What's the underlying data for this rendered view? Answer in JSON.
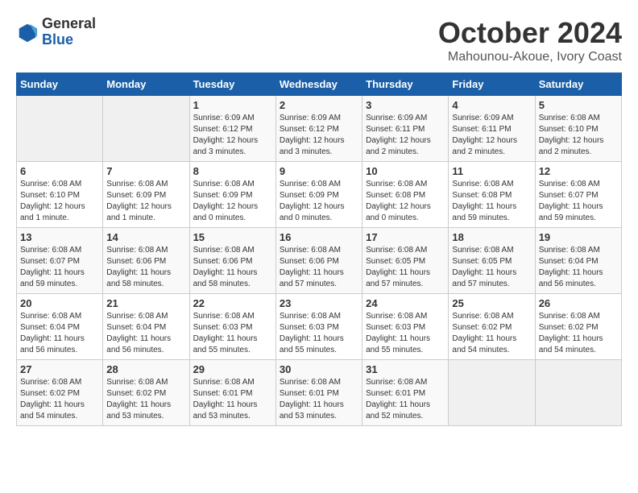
{
  "header": {
    "logo_general": "General",
    "logo_blue": "Blue",
    "title": "October 2024",
    "subtitle": "Mahounou-Akoue, Ivory Coast"
  },
  "weekdays": [
    "Sunday",
    "Monday",
    "Tuesday",
    "Wednesday",
    "Thursday",
    "Friday",
    "Saturday"
  ],
  "weeks": [
    [
      {
        "day": "",
        "empty": true
      },
      {
        "day": "",
        "empty": true
      },
      {
        "day": "1",
        "sunrise": "Sunrise: 6:09 AM",
        "sunset": "Sunset: 6:12 PM",
        "daylight": "Daylight: 12 hours and 3 minutes."
      },
      {
        "day": "2",
        "sunrise": "Sunrise: 6:09 AM",
        "sunset": "Sunset: 6:12 PM",
        "daylight": "Daylight: 12 hours and 3 minutes."
      },
      {
        "day": "3",
        "sunrise": "Sunrise: 6:09 AM",
        "sunset": "Sunset: 6:11 PM",
        "daylight": "Daylight: 12 hours and 2 minutes."
      },
      {
        "day": "4",
        "sunrise": "Sunrise: 6:09 AM",
        "sunset": "Sunset: 6:11 PM",
        "daylight": "Daylight: 12 hours and 2 minutes."
      },
      {
        "day": "5",
        "sunrise": "Sunrise: 6:08 AM",
        "sunset": "Sunset: 6:10 PM",
        "daylight": "Daylight: 12 hours and 2 minutes."
      }
    ],
    [
      {
        "day": "6",
        "sunrise": "Sunrise: 6:08 AM",
        "sunset": "Sunset: 6:10 PM",
        "daylight": "Daylight: 12 hours and 1 minute."
      },
      {
        "day": "7",
        "sunrise": "Sunrise: 6:08 AM",
        "sunset": "Sunset: 6:09 PM",
        "daylight": "Daylight: 12 hours and 1 minute."
      },
      {
        "day": "8",
        "sunrise": "Sunrise: 6:08 AM",
        "sunset": "Sunset: 6:09 PM",
        "daylight": "Daylight: 12 hours and 0 minutes."
      },
      {
        "day": "9",
        "sunrise": "Sunrise: 6:08 AM",
        "sunset": "Sunset: 6:09 PM",
        "daylight": "Daylight: 12 hours and 0 minutes."
      },
      {
        "day": "10",
        "sunrise": "Sunrise: 6:08 AM",
        "sunset": "Sunset: 6:08 PM",
        "daylight": "Daylight: 12 hours and 0 minutes."
      },
      {
        "day": "11",
        "sunrise": "Sunrise: 6:08 AM",
        "sunset": "Sunset: 6:08 PM",
        "daylight": "Daylight: 11 hours and 59 minutes."
      },
      {
        "day": "12",
        "sunrise": "Sunrise: 6:08 AM",
        "sunset": "Sunset: 6:07 PM",
        "daylight": "Daylight: 11 hours and 59 minutes."
      }
    ],
    [
      {
        "day": "13",
        "sunrise": "Sunrise: 6:08 AM",
        "sunset": "Sunset: 6:07 PM",
        "daylight": "Daylight: 11 hours and 59 minutes."
      },
      {
        "day": "14",
        "sunrise": "Sunrise: 6:08 AM",
        "sunset": "Sunset: 6:06 PM",
        "daylight": "Daylight: 11 hours and 58 minutes."
      },
      {
        "day": "15",
        "sunrise": "Sunrise: 6:08 AM",
        "sunset": "Sunset: 6:06 PM",
        "daylight": "Daylight: 11 hours and 58 minutes."
      },
      {
        "day": "16",
        "sunrise": "Sunrise: 6:08 AM",
        "sunset": "Sunset: 6:06 PM",
        "daylight": "Daylight: 11 hours and 57 minutes."
      },
      {
        "day": "17",
        "sunrise": "Sunrise: 6:08 AM",
        "sunset": "Sunset: 6:05 PM",
        "daylight": "Daylight: 11 hours and 57 minutes."
      },
      {
        "day": "18",
        "sunrise": "Sunrise: 6:08 AM",
        "sunset": "Sunset: 6:05 PM",
        "daylight": "Daylight: 11 hours and 57 minutes."
      },
      {
        "day": "19",
        "sunrise": "Sunrise: 6:08 AM",
        "sunset": "Sunset: 6:04 PM",
        "daylight": "Daylight: 11 hours and 56 minutes."
      }
    ],
    [
      {
        "day": "20",
        "sunrise": "Sunrise: 6:08 AM",
        "sunset": "Sunset: 6:04 PM",
        "daylight": "Daylight: 11 hours and 56 minutes."
      },
      {
        "day": "21",
        "sunrise": "Sunrise: 6:08 AM",
        "sunset": "Sunset: 6:04 PM",
        "daylight": "Daylight: 11 hours and 56 minutes."
      },
      {
        "day": "22",
        "sunrise": "Sunrise: 6:08 AM",
        "sunset": "Sunset: 6:03 PM",
        "daylight": "Daylight: 11 hours and 55 minutes."
      },
      {
        "day": "23",
        "sunrise": "Sunrise: 6:08 AM",
        "sunset": "Sunset: 6:03 PM",
        "daylight": "Daylight: 11 hours and 55 minutes."
      },
      {
        "day": "24",
        "sunrise": "Sunrise: 6:08 AM",
        "sunset": "Sunset: 6:03 PM",
        "daylight": "Daylight: 11 hours and 55 minutes."
      },
      {
        "day": "25",
        "sunrise": "Sunrise: 6:08 AM",
        "sunset": "Sunset: 6:02 PM",
        "daylight": "Daylight: 11 hours and 54 minutes."
      },
      {
        "day": "26",
        "sunrise": "Sunrise: 6:08 AM",
        "sunset": "Sunset: 6:02 PM",
        "daylight": "Daylight: 11 hours and 54 minutes."
      }
    ],
    [
      {
        "day": "27",
        "sunrise": "Sunrise: 6:08 AM",
        "sunset": "Sunset: 6:02 PM",
        "daylight": "Daylight: 11 hours and 54 minutes."
      },
      {
        "day": "28",
        "sunrise": "Sunrise: 6:08 AM",
        "sunset": "Sunset: 6:02 PM",
        "daylight": "Daylight: 11 hours and 53 minutes."
      },
      {
        "day": "29",
        "sunrise": "Sunrise: 6:08 AM",
        "sunset": "Sunset: 6:01 PM",
        "daylight": "Daylight: 11 hours and 53 minutes."
      },
      {
        "day": "30",
        "sunrise": "Sunrise: 6:08 AM",
        "sunset": "Sunset: 6:01 PM",
        "daylight": "Daylight: 11 hours and 53 minutes."
      },
      {
        "day": "31",
        "sunrise": "Sunrise: 6:08 AM",
        "sunset": "Sunset: 6:01 PM",
        "daylight": "Daylight: 11 hours and 52 minutes."
      },
      {
        "day": "",
        "empty": true
      },
      {
        "day": "",
        "empty": true
      }
    ]
  ]
}
